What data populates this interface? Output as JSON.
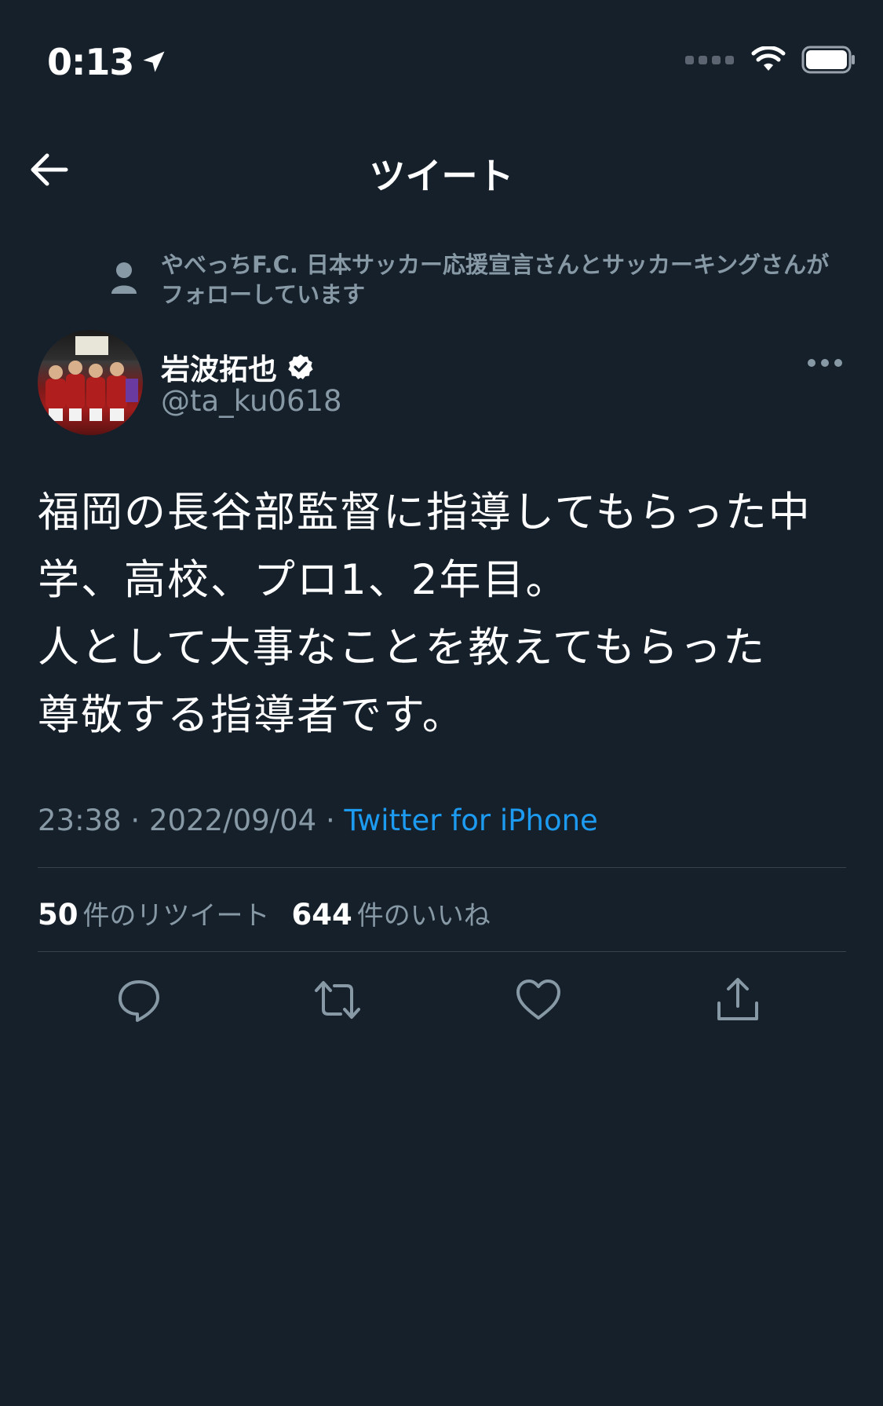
{
  "status_bar": {
    "time": "0:13"
  },
  "nav": {
    "title": "ツイート"
  },
  "social_context": {
    "text": "やべっちF.C. 日本サッカー応援宣言さんとサッカーキングさんがフォローしています"
  },
  "author": {
    "name": "岩波拓也",
    "handle": "@ta_ku0618"
  },
  "tweet": {
    "text": "福岡の長谷部監督に指導してもらった中\n学、高校、プロ1、2年目。\n人として大事なことを教えてもらった\n尊敬する指導者です。",
    "time": "23:38",
    "date": "2022/09/04",
    "separator": "·",
    "source": "Twitter for iPhone"
  },
  "stats": {
    "retweets_count": "50",
    "retweets_label": "件のリツイート",
    "likes_count": "644",
    "likes_label": "件のいいね"
  },
  "colors": {
    "background": "#15202b",
    "secondary_text": "#8899a6",
    "accent": "#1d9bf0",
    "divider": "#38444d"
  },
  "icons": [
    "location-arrow-icon",
    "signal-icon",
    "wifi-icon",
    "battery-icon",
    "back-arrow-icon",
    "person-icon",
    "verified-badge-icon",
    "more-icon",
    "reply-icon",
    "retweet-icon",
    "like-icon",
    "share-icon"
  ]
}
